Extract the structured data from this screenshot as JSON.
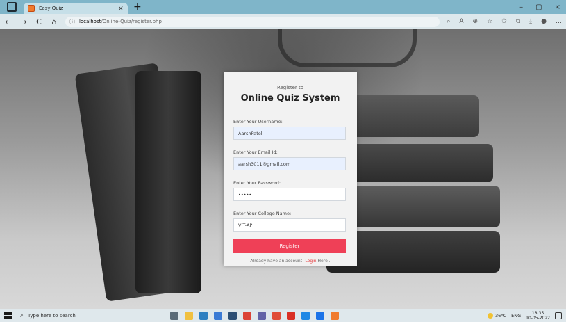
{
  "browser": {
    "tab_title": "Easy Quiz",
    "tab_close": "×",
    "new_tab": "+",
    "url_info_icon": "ⓘ",
    "url_host": "localhost",
    "url_path": "/Online-Quiz/register.php",
    "nav": {
      "back": "←",
      "forward": "→",
      "refresh": "C",
      "home": "⌂"
    },
    "win_controls": {
      "minimize": "–",
      "maximize": "▢",
      "close": "×"
    },
    "toolbar_icons": [
      "search-icon",
      "read-aloud-icon",
      "zoom-icon",
      "favorite-icon",
      "favorites-icon",
      "collections-icon",
      "downloads-icon",
      "profile-icon",
      "more-icon"
    ],
    "toolbar_glyphs": {
      "search": "⌕",
      "read_aloud": "A",
      "zoom": "⊕",
      "favorite": "☆",
      "favorites": "✩",
      "collections": "⧉",
      "downloads": "⤓",
      "profile": "●",
      "more": "…"
    }
  },
  "card": {
    "subtitle": "Register to",
    "title": "Online Quiz System",
    "fields": [
      {
        "label": "Enter Your Username:",
        "value": "AarshPatel",
        "autofilled": true
      },
      {
        "label": "Enter Your Email Id:",
        "value": "aarsh3011@gmail.com",
        "autofilled": true
      },
      {
        "label": "Enter Your Password:",
        "value": "•••••",
        "autofilled": false
      },
      {
        "label": "Enter Your College Name:",
        "value": "VIT-AP",
        "autofilled": false
      }
    ],
    "register_label": "Register",
    "login_prefix": "Already have an account!",
    "login_link": "Login",
    "login_suffix": "Here.."
  },
  "taskbar": {
    "search_placeholder": "Type here to search",
    "search_icon": "⌕",
    "temperature": "36°C",
    "language": "ENG",
    "time": "18:35",
    "date": "10-05-2022"
  },
  "colors": {
    "accent": "#ef4057",
    "login_link": "#e5383b",
    "autofill": "#e8f0fe",
    "titlebar": "#7fb5c9"
  }
}
